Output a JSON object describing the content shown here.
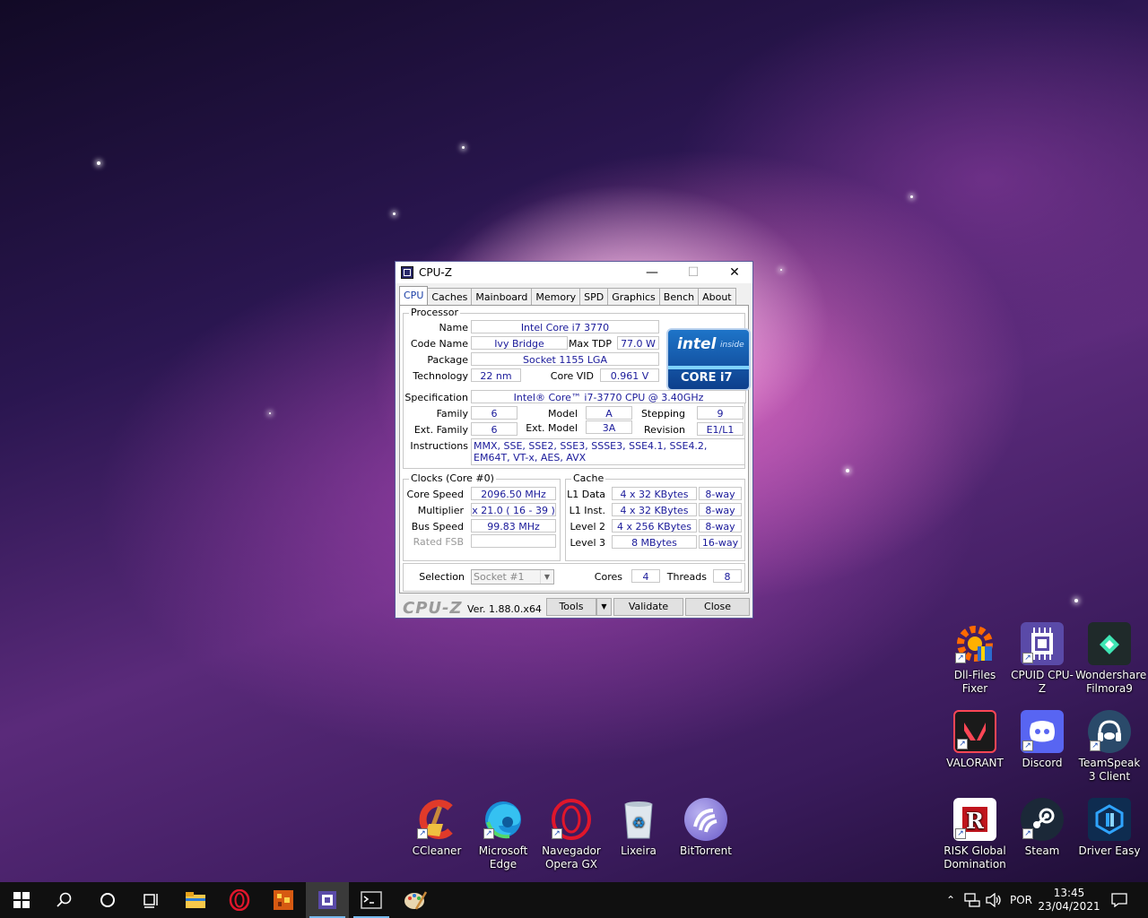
{
  "window": {
    "title": "CPU-Z",
    "tabs": [
      "CPU",
      "Caches",
      "Mainboard",
      "Memory",
      "SPD",
      "Graphics",
      "Bench",
      "About"
    ],
    "processor": {
      "group": "Processor",
      "name_label": "Name",
      "name": "Intel Core i7 3770",
      "codename_label": "Code Name",
      "codename": "Ivy Bridge",
      "maxtdp_label": "Max TDP",
      "maxtdp": "77.0 W",
      "package_label": "Package",
      "package": "Socket 1155 LGA",
      "technology_label": "Technology",
      "technology": "22 nm",
      "corevid_label": "Core VID",
      "corevid": "0.961 V",
      "spec_label": "Specification",
      "spec": "Intel® Core™ i7-3770 CPU @ 3.40GHz",
      "family_label": "Family",
      "family": "6",
      "model_label": "Model",
      "model": "A",
      "stepping_label": "Stepping",
      "stepping": "9",
      "extfamily_label": "Ext. Family",
      "extfamily": "6",
      "extmodel_label": "Ext. Model",
      "extmodel": "3A",
      "revision_label": "Revision",
      "revision": "E1/L1",
      "instructions_label": "Instructions",
      "instructions": "MMX, SSE, SSE2, SSE3, SSSE3, SSE4.1, SSE4.2, EM64T, VT-x, AES, AVX",
      "logo_brand": "intel",
      "logo_inside": "inside",
      "logo_core": "CORE i7"
    },
    "clocks": {
      "group": "Clocks (Core #0)",
      "corespeed_label": "Core Speed",
      "corespeed": "2096.50 MHz",
      "multiplier_label": "Multiplier",
      "multiplier": "x 21.0 ( 16 - 39 )",
      "busspeed_label": "Bus Speed",
      "busspeed": "99.83 MHz",
      "ratedfsb_label": "Rated FSB",
      "ratedfsb": ""
    },
    "cache": {
      "group": "Cache",
      "rows": [
        {
          "label": "L1 Data",
          "size": "4 x 32 KBytes",
          "way": "8-way"
        },
        {
          "label": "L1 Inst.",
          "size": "4 x 32 KBytes",
          "way": "8-way"
        },
        {
          "label": "Level 2",
          "size": "4 x 256 KBytes",
          "way": "8-way"
        },
        {
          "label": "Level 3",
          "size": "8 MBytes",
          "way": "16-way"
        }
      ]
    },
    "selection": {
      "label": "Selection",
      "value": "Socket #1",
      "cores_label": "Cores",
      "cores": "4",
      "threads_label": "Threads",
      "threads": "8"
    },
    "footer": {
      "logo": "CPU-Z",
      "version": "Ver. 1.88.0.x64",
      "tools": "Tools",
      "validate": "Validate",
      "close": "Close"
    }
  },
  "desktop_icons": [
    {
      "label": "Dll-Files Fixer",
      "icon": "dll-fixer-icon",
      "color": "#ff6a00"
    },
    {
      "label": "CPUID CPU-Z",
      "icon": "cpuz-icon",
      "color": "#5a4aa8"
    },
    {
      "label": "Wondershare Filmora9",
      "icon": "filmora-icon",
      "color": "#1f2a2a"
    },
    {
      "label": "VALORANT",
      "icon": "valorant-icon",
      "color": "#ff4655"
    },
    {
      "label": "Discord",
      "icon": "discord-icon",
      "color": "#5865f2"
    },
    {
      "label": "TeamSpeak 3 Client",
      "icon": "teamspeak-icon",
      "color": "#2a4a6a"
    },
    {
      "label": "CCleaner",
      "icon": "ccleaner-icon",
      "color": "#e03a2a"
    },
    {
      "label": "Microsoft Edge",
      "icon": "edge-icon",
      "color": "#1a8fd8"
    },
    {
      "label": "Navegador Opera GX",
      "icon": "opera-gx-icon",
      "color": "#e0162b"
    },
    {
      "label": "Lixeira",
      "icon": "recycle-bin-icon",
      "color": "#cfd8e0"
    },
    {
      "label": "BitTorrent",
      "icon": "bittorrent-icon",
      "color": "#7a6ad0"
    },
    {
      "label": "RISK Global Domination",
      "icon": "risk-icon",
      "color": "#c0141c"
    },
    {
      "label": "Steam",
      "icon": "steam-icon",
      "color": "#1b2838"
    },
    {
      "label": "Driver Easy",
      "icon": "driver-easy-icon",
      "color": "#1e7fd0"
    }
  ],
  "taskbar": {
    "language": "POR",
    "time": "13:45",
    "date": "23/04/2021"
  }
}
